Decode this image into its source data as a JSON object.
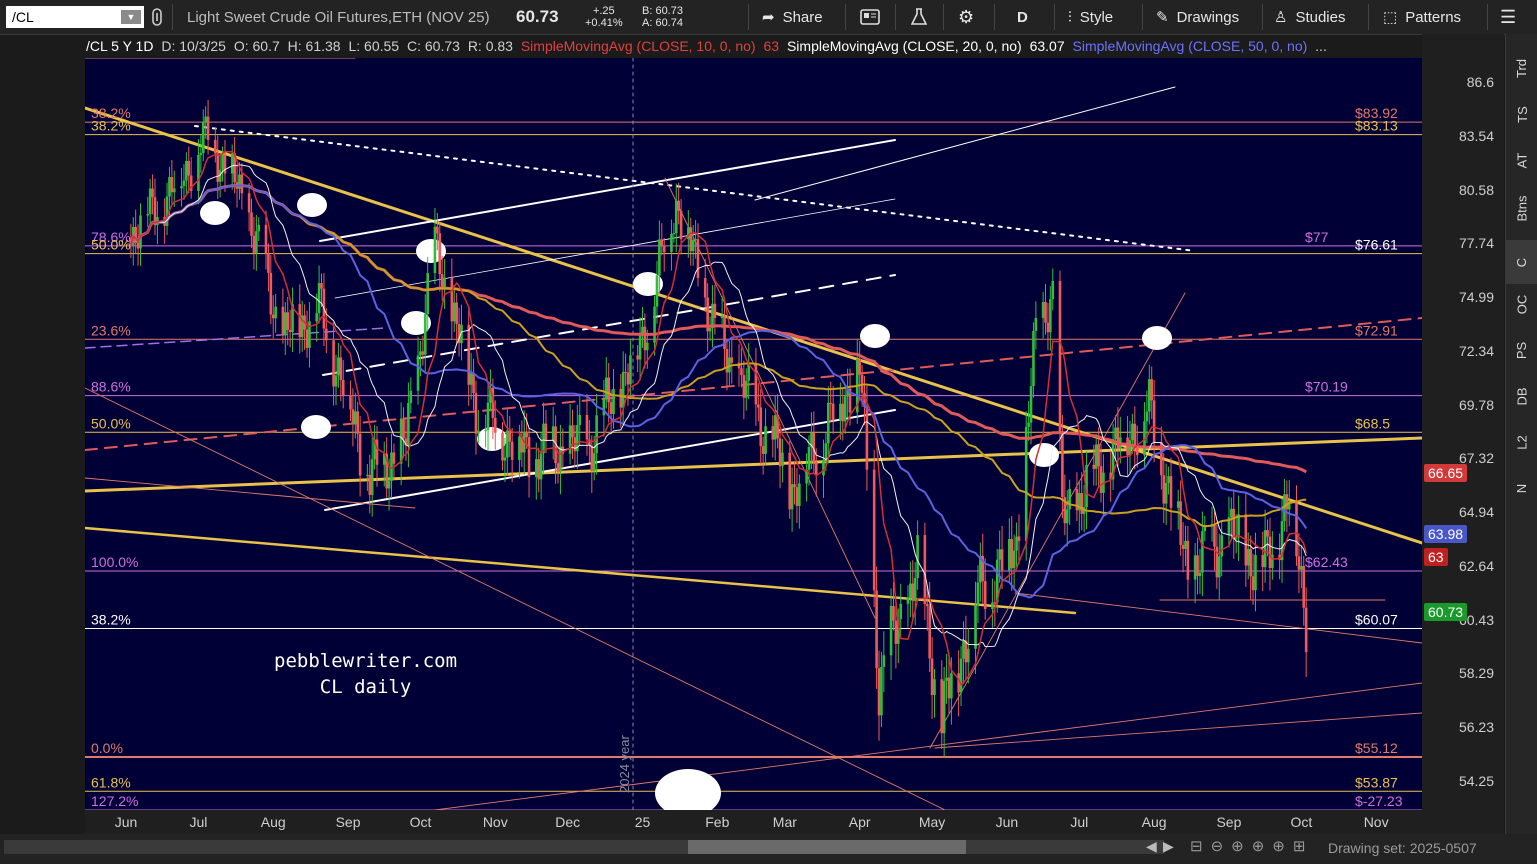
{
  "toolbar": {
    "symbol": "/CL",
    "description": "Light Sweet Crude Oil Futures,ETH (NOV 25)",
    "last": "60.73",
    "change": "+.25",
    "change_pct": "+0.41%",
    "bid": "B: 60.73",
    "ask": "A: 60.74",
    "share": "Share",
    "period": "D",
    "style": "Style",
    "drawings": "Drawings",
    "studies": "Studies",
    "patterns": "Patterns"
  },
  "legend": {
    "symbol_period": "/CL 5 Y 1D",
    "date": "D: 10/3/25",
    "open": "O: 60.7",
    "high": "H: 61.38",
    "low": "L: 60.55",
    "close": "C: 60.73",
    "range": "R: 0.83",
    "sma10": "SimpleMovingAvg (CLOSE, 10, 0, no)",
    "sma10_val": "63",
    "sma20": "SimpleMovingAvg (CLOSE, 20, 0, no)",
    "sma20_val": "63.07",
    "sma50": "SimpleMovingAvg (CLOSE, 50, 0, no)",
    "ellipsis": "..."
  },
  "annotations": {
    "site": "pebblewriter.com",
    "subtitle": "CL daily",
    "year_marker": "2024 year"
  },
  "fib_labels": [
    {
      "text": "38.2%",
      "price": 84.3,
      "side": "left",
      "color": "#e07a6a"
    },
    {
      "text": "38.2%",
      "price": 83.6,
      "side": "left",
      "color": "#e8c24a"
    },
    {
      "text": "78.6%",
      "price": 77.6,
      "side": "left",
      "color": "#cf6fe0"
    },
    {
      "text": "50.0%",
      "price": 77.2,
      "side": "left",
      "color": "#e8c24a"
    },
    {
      "text": "23.6%",
      "price": 72.9,
      "side": "left",
      "color": "#e07a6a"
    },
    {
      "text": "88.6%",
      "price": 70.2,
      "side": "left",
      "color": "#cf6fe0"
    },
    {
      "text": "50.0%",
      "price": 68.5,
      "side": "left",
      "color": "#e8c24a"
    },
    {
      "text": "100.0%",
      "price": 62.43,
      "side": "left",
      "color": "#cf6fe0"
    },
    {
      "text": "38.2%",
      "price": 60.07,
      "side": "left",
      "color": "#ffffff"
    },
    {
      "text": "0.0%",
      "price": 55.12,
      "side": "left",
      "color": "#e07a6a"
    },
    {
      "text": "61.8%",
      "price": 53.87,
      "side": "left",
      "color": "#e8c24a"
    },
    {
      "text": "127.2%",
      "price": 53.2,
      "side": "left",
      "color": "#cf6fe0"
    },
    {
      "text": "$83.92",
      "price": 84.3,
      "side": "right",
      "color": "#e07a6a"
    },
    {
      "text": "$83.13",
      "price": 83.6,
      "side": "right",
      "color": "#e8c24a"
    },
    {
      "text": "$77",
      "price": 77.6,
      "side": "mid",
      "color": "#cf6fe0"
    },
    {
      "text": "$76.61",
      "price": 77.2,
      "side": "right",
      "color": "#ffffff"
    },
    {
      "text": "$72.91",
      "price": 72.9,
      "side": "right",
      "color": "#e07a6a"
    },
    {
      "text": "$70.19",
      "price": 70.2,
      "side": "mid",
      "color": "#cf6fe0"
    },
    {
      "text": "$68.5",
      "price": 68.5,
      "side": "right",
      "color": "#e8c24a"
    },
    {
      "text": "$62.43",
      "price": 62.43,
      "side": "mid",
      "color": "#cf6fe0"
    },
    {
      "text": "$60.07",
      "price": 60.07,
      "side": "right",
      "color": "#ffffff"
    },
    {
      "text": "$55.12",
      "price": 55.12,
      "side": "right",
      "color": "#e07a6a"
    },
    {
      "text": "$53.87",
      "price": 53.87,
      "side": "right",
      "color": "#e8c24a"
    },
    {
      "text": "$-27.23",
      "price": 53.2,
      "side": "right",
      "color": "#cf6fe0"
    }
  ],
  "price_badges": [
    {
      "text": "66.65",
      "price": 66.65,
      "color": "#d23a3a"
    },
    {
      "text": "63.98",
      "price": 63.98,
      "color": "#4a57c8"
    },
    {
      "text": "63",
      "price": 63.0,
      "color": "#c02020"
    },
    {
      "text": "60.73",
      "price": 60.73,
      "color": "#1a9a2a"
    }
  ],
  "right_tabs": [
    "Trd",
    "TS",
    "AT",
    "Btns",
    "C",
    "OC",
    "PS",
    "DB",
    "L2",
    "N"
  ],
  "status": {
    "drawing_set": "Drawing set: 2025-0507"
  },
  "colors": {
    "plot_bg": "#000036",
    "up": "#2fbf3a",
    "down": "#f05a5a",
    "sma10": "#d43030",
    "sma20": "#f0f0f0",
    "sma50": "#5a62e0",
    "sma100": "#c9a020",
    "sma200": "#e05a5a"
  },
  "chart_data": {
    "type": "candlestick",
    "title": "Light Sweet Crude Oil Futures,ETH (NOV 25)",
    "x_ticks": [
      "Jun",
      "Jul",
      "Aug",
      "Sep",
      "Oct",
      "Nov",
      "Dec",
      "25",
      "Feb",
      "Mar",
      "Apr",
      "May",
      "Jun",
      "Jul",
      "Aug",
      "Sep",
      "Oct",
      "Nov"
    ],
    "y_ticks": [
      86.6,
      83.54,
      80.58,
      77.74,
      74.99,
      72.34,
      69.78,
      67.32,
      64.94,
      62.64,
      60.43,
      58.29,
      56.23,
      54.25
    ],
    "y_scale": "log",
    "ylim": [
      53.2,
      88.0
    ],
    "close_path": [
      {
        "x": "2024-06-01",
        "y": 78.0
      },
      {
        "x": "2024-06-20",
        "y": 80.5
      },
      {
        "x": "2024-07-05",
        "y": 83.5
      },
      {
        "x": "2024-07-20",
        "y": 80.0
      },
      {
        "x": "2024-08-05",
        "y": 73.0
      },
      {
        "x": "2024-08-20",
        "y": 74.5
      },
      {
        "x": "2024-09-10",
        "y": 66.5
      },
      {
        "x": "2024-09-25",
        "y": 68.0
      },
      {
        "x": "2024-10-07",
        "y": 77.5
      },
      {
        "x": "2024-10-25",
        "y": 69.5
      },
      {
        "x": "2024-11-15",
        "y": 67.5
      },
      {
        "x": "2024-12-10",
        "y": 68.0
      },
      {
        "x": "2024-12-31",
        "y": 72.5
      },
      {
        "x": "2025-01-15",
        "y": 80.0
      },
      {
        "x": "2025-02-01",
        "y": 73.0
      },
      {
        "x": "2025-03-05",
        "y": 66.0
      },
      {
        "x": "2025-04-01",
        "y": 71.5
      },
      {
        "x": "2025-04-09",
        "y": 58.0
      },
      {
        "x": "2025-04-25",
        "y": 62.5
      },
      {
        "x": "2025-05-05",
        "y": 56.5
      },
      {
        "x": "2025-05-20",
        "y": 61.5
      },
      {
        "x": "2025-06-05",
        "y": 63.5
      },
      {
        "x": "2025-06-13",
        "y": 73.0
      },
      {
        "x": "2025-06-20",
        "y": 75.5
      },
      {
        "x": "2025-06-24",
        "y": 64.5
      },
      {
        "x": "2025-07-10",
        "y": 67.0
      },
      {
        "x": "2025-07-30",
        "y": 69.5
      },
      {
        "x": "2025-08-15",
        "y": 62.5
      },
      {
        "x": "2025-09-01",
        "y": 64.0
      },
      {
        "x": "2025-09-15",
        "y": 62.5
      },
      {
        "x": "2025-09-26",
        "y": 65.5
      },
      {
        "x": "2025-10-03",
        "y": 60.73
      }
    ],
    "moving_averages": [
      {
        "name": "SMA 10",
        "length": 10,
        "last": 63
      },
      {
        "name": "SMA 20",
        "length": 20,
        "last": 63.07
      },
      {
        "name": "SMA 50",
        "length": 50,
        "last": 63.98
      }
    ]
  }
}
